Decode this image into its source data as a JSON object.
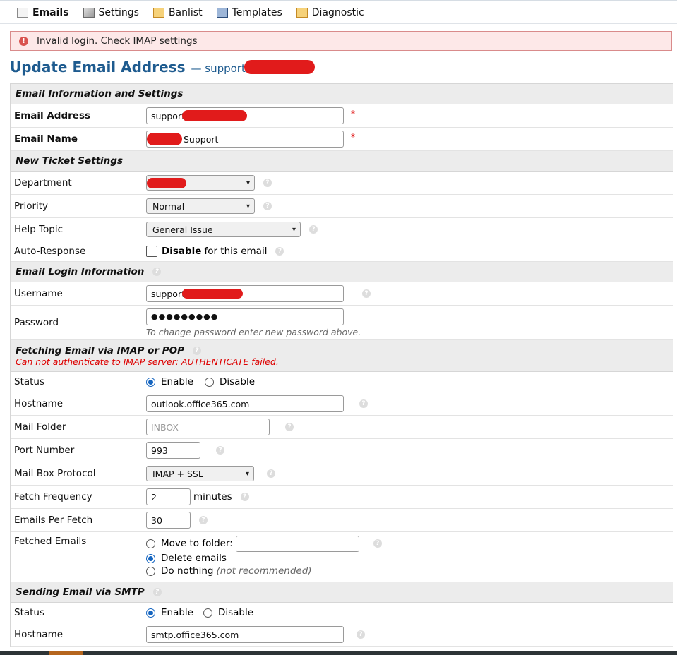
{
  "nav": {
    "items": [
      {
        "label": "Emails",
        "icon": "mail-icon",
        "active": true
      },
      {
        "label": "Settings",
        "icon": "settings-icon"
      },
      {
        "label": "Banlist",
        "icon": "banlist-icon"
      },
      {
        "label": "Templates",
        "icon": "templates-icon"
      },
      {
        "label": "Diagnostic",
        "icon": "diagnostic-icon"
      }
    ]
  },
  "alert": {
    "icon": "!",
    "text": "Invalid login. Check IMAP settings"
  },
  "title": {
    "main": "Update Email Address",
    "sub": "— support"
  },
  "sections": {
    "email_info": "Email Information and Settings",
    "new_ticket": "New Ticket Settings",
    "login": "Email Login Information",
    "fetching": "Fetching Email via IMAP or POP",
    "fetching_error": "Can not authenticate to IMAP server: AUTHENTICATE failed.",
    "smtp": "Sending Email via SMTP"
  },
  "fields": {
    "email_address": {
      "label": "Email Address",
      "value": "support"
    },
    "email_name": {
      "label": "Email Name",
      "value": "Support"
    },
    "department": {
      "label": "Department",
      "value": ""
    },
    "priority": {
      "label": "Priority",
      "value": "Normal"
    },
    "help_topic": {
      "label": "Help Topic",
      "value": "General Issue"
    },
    "auto_response": {
      "label": "Auto-Response",
      "option_bold": "Disable",
      "option_rest": "for this email"
    },
    "username": {
      "label": "Username",
      "value": "support"
    },
    "password": {
      "label": "Password",
      "value": "●●●●●●●●●",
      "hint": "To change password enter new password above."
    },
    "fetch_status": {
      "label": "Status",
      "enable": "Enable",
      "disable": "Disable"
    },
    "hostname": {
      "label": "Hostname",
      "value": "outlook.office365.com"
    },
    "mail_folder": {
      "label": "Mail Folder",
      "placeholder": "INBOX"
    },
    "port": {
      "label": "Port Number",
      "value": "993"
    },
    "protocol": {
      "label": "Mail Box Protocol",
      "value": "IMAP + SSL"
    },
    "frequency": {
      "label": "Fetch Frequency",
      "value": "2",
      "unit": "minutes"
    },
    "per_fetch": {
      "label": "Emails Per Fetch",
      "value": "30"
    },
    "fetched": {
      "label": "Fetched Emails",
      "move": "Move to folder:",
      "delete": "Delete emails",
      "nothing": "Do nothing",
      "nothing_note": "(not recommended)"
    },
    "smtp_status": {
      "label": "Status",
      "enable": "Enable",
      "disable": "Disable"
    },
    "smtp_hostname": {
      "label": "Hostname",
      "value": "smtp.office365.com"
    }
  },
  "required_mark": "*",
  "help_mark": "?"
}
